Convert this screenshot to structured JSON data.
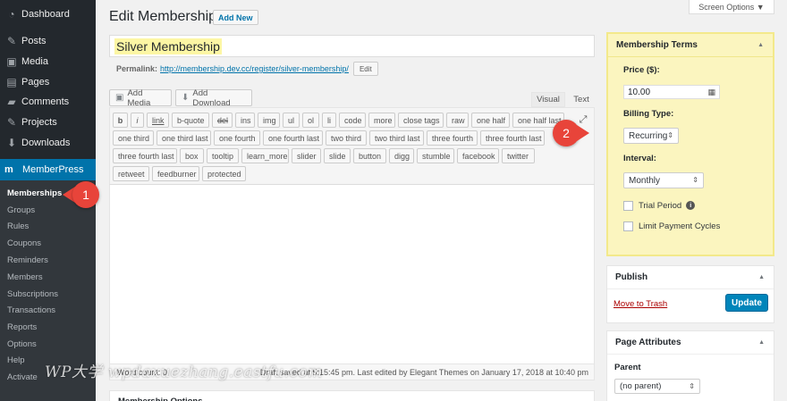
{
  "sidebar": {
    "items": [
      {
        "label": "Dashboard",
        "icon": "dashboard-icon"
      },
      {
        "label": "Posts",
        "icon": "pin-icon"
      },
      {
        "label": "Media",
        "icon": "media-icon"
      },
      {
        "label": "Pages",
        "icon": "page-icon"
      },
      {
        "label": "Comments",
        "icon": "comment-icon"
      },
      {
        "label": "Projects",
        "icon": "pin-icon"
      },
      {
        "label": "Downloads",
        "icon": "download-icon"
      }
    ],
    "memberpress": {
      "label": "MemberPress",
      "icon": "memberpress-logo-icon",
      "subitems": [
        "Memberships",
        "Groups",
        "Rules",
        "Coupons",
        "Reminders",
        "Members",
        "Subscriptions",
        "Transactions",
        "Reports",
        "Options",
        "Help",
        "Activate"
      ],
      "current": "Memberships"
    }
  },
  "callouts": [
    "1",
    "2"
  ],
  "header": {
    "title": "Edit Membership",
    "add_new": "Add New",
    "screen_options": "Screen Options ▼"
  },
  "post": {
    "title": "Silver Membership",
    "permalink_label": "Permalink:",
    "permalink_url": "http://membership.dev.cc/register/silver-membership/",
    "permalink_edit": "Edit"
  },
  "editor": {
    "add_media": "Add Media",
    "add_download": "Add Download",
    "tab_visual": "Visual",
    "tab_text": "Text",
    "quicktags": [
      [
        "b",
        "i",
        "link",
        "b-quote",
        "del",
        "ins",
        "img",
        "ul",
        "ol",
        "li",
        "code",
        "more",
        "close tags",
        "raw",
        "one half",
        "one half last"
      ],
      [
        "one third",
        "one third last",
        "one fourth",
        "one fourth last",
        "two third",
        "two third last",
        "three fourth",
        "three fourth last"
      ],
      [
        "three fourth last",
        "box",
        "tooltip",
        "learn_more",
        "slider",
        "slide",
        "button",
        "digg",
        "stumble",
        "facebook",
        "twitter"
      ],
      [
        "retweet",
        "feedburner",
        "protected"
      ]
    ],
    "word_count": "Word count: 0",
    "draft_status": "Draft saved at 5:15:45 pm. Last edited by Elegant Themes on January 17, 2018 at 10:40 pm",
    "below_box_title": "Membership Options"
  },
  "watermark": "WP大学 wpdaxuezhang.eastfu.com",
  "membership_terms": {
    "title": "Membership Terms",
    "price_label": "Price ($):",
    "price_value": "10.00",
    "billing_label": "Billing Type:",
    "billing_value": "Recurring",
    "interval_label": "Interval:",
    "interval_value": "Monthly",
    "trial_label": "Trial Period",
    "limit_label": "Limit Payment Cycles"
  },
  "publish": {
    "title": "Publish",
    "trash": "Move to Trash",
    "update": "Update"
  },
  "page_attributes": {
    "title": "Page Attributes",
    "parent_label": "Parent",
    "parent_value": "(no parent)"
  }
}
